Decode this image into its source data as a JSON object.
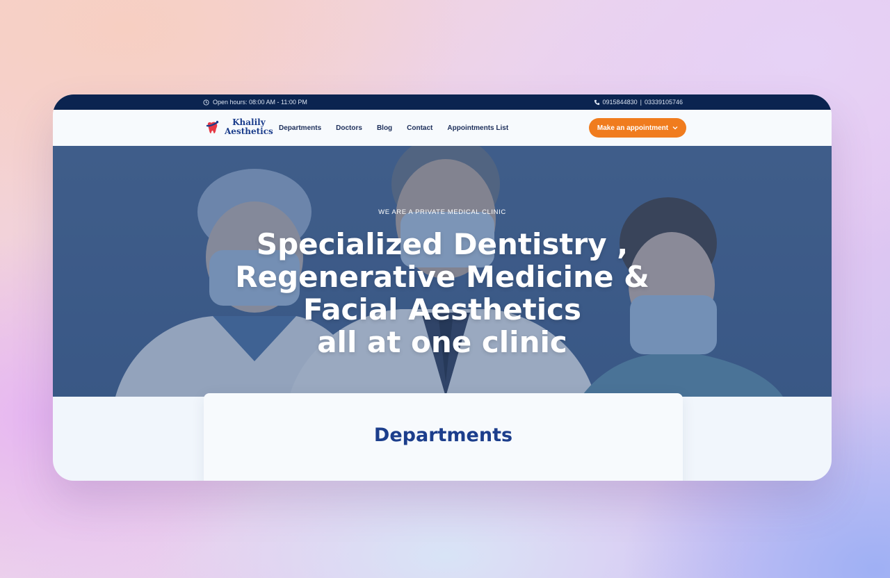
{
  "topbar": {
    "hours": "Open hours: 08:00 AM - 11:00 PM",
    "phone1": "0915844830",
    "separator": "|",
    "phone2": "03339105746"
  },
  "logo": {
    "line1": "Khalily",
    "line2": "Aesthetics"
  },
  "nav": {
    "items": [
      {
        "label": "Departments"
      },
      {
        "label": "Doctors"
      },
      {
        "label": "Blog"
      },
      {
        "label": "Contact"
      },
      {
        "label": "Appointments List"
      }
    ],
    "cta": "Make an appointment"
  },
  "hero": {
    "eyebrow": "WE ARE A PRIVATE MEDICAL CLINIC",
    "lines": [
      "Specialized Dentistry ,",
      "Regenerative Medicine &",
      "Facial Aesthetics",
      "all at one clinic"
    ]
  },
  "section": {
    "title": "Departments"
  },
  "colors": {
    "topbar": "#0b2450",
    "accent": "#f07c1e",
    "brand": "#1c3e8c"
  },
  "icons": [
    "clock-icon",
    "phone-icon",
    "tooth-logo-icon",
    "chevron-down-icon"
  ]
}
